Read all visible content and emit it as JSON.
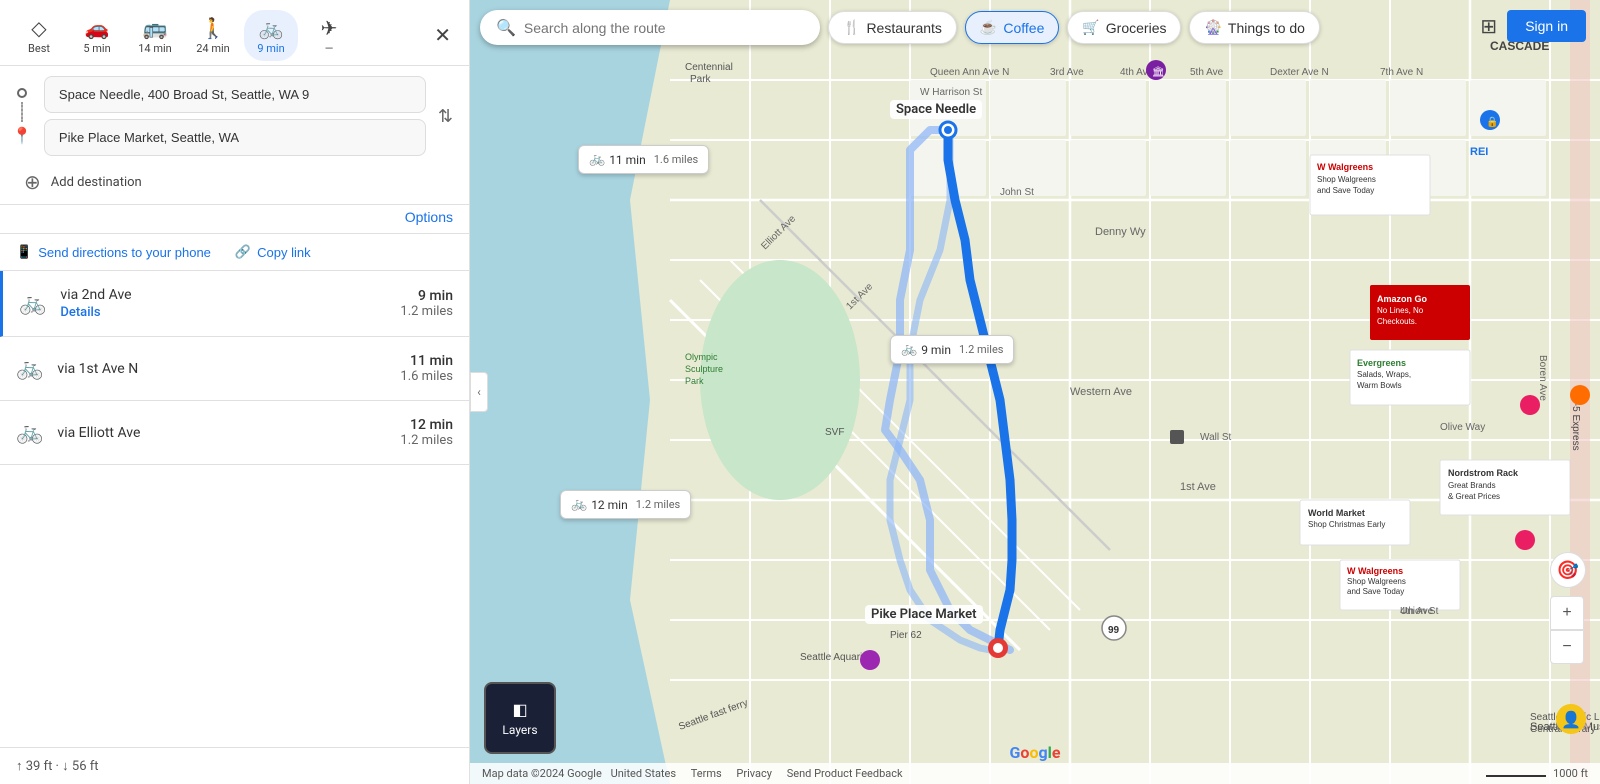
{
  "transport_options": [
    {
      "id": "best",
      "icon": "◇",
      "label": "Best",
      "active": false
    },
    {
      "id": "car",
      "icon": "🚗",
      "label": "5 min",
      "active": false
    },
    {
      "id": "transit",
      "icon": "🚌",
      "label": "14 min",
      "active": false
    },
    {
      "id": "walk",
      "icon": "🚶",
      "label": "24 min",
      "active": false
    },
    {
      "id": "bike",
      "icon": "🚲",
      "label": "9 min",
      "active": true
    },
    {
      "id": "flight",
      "icon": "✈",
      "label": "—",
      "active": false
    }
  ],
  "origin": "Space Needle, 400 Broad St, Seattle, WA 9",
  "destination": "Pike Place Market, Seattle, WA",
  "add_destination": "Add destination",
  "options_label": "Options",
  "send_directions_label": "Send directions to your phone",
  "copy_link_label": "Copy link",
  "routes": [
    {
      "id": "route1",
      "via": "via 2nd Ave",
      "time": "9 min",
      "distance": "1.2 miles",
      "show_details": true,
      "selected": true
    },
    {
      "id": "route2",
      "via": "via 1st Ave N",
      "time": "11 min",
      "distance": "1.6 miles",
      "show_details": false,
      "selected": false
    },
    {
      "id": "route3",
      "via": "via Elliott Ave",
      "time": "12 min",
      "distance": "1.2 miles",
      "show_details": false,
      "selected": false
    }
  ],
  "details_label": "Details",
  "elevation": "↑ 39 ft · ↓ 56 ft",
  "search_placeholder": "Search along the route",
  "filter_buttons": [
    {
      "id": "restaurants",
      "icon": "🍴",
      "label": "Restaurants",
      "active": false
    },
    {
      "id": "coffee",
      "icon": "☕",
      "label": "Coffee",
      "active": true
    },
    {
      "id": "groceries",
      "icon": "🛒",
      "label": "Groceries",
      "active": false
    },
    {
      "id": "things_to_do",
      "icon": "🎡",
      "label": "Things to do",
      "active": false
    }
  ],
  "sign_in_label": "Sign in",
  "layers_label": "Layers",
  "route_map_labels": [
    {
      "id": "r1",
      "time": "9 min",
      "dist": "1.2 miles"
    },
    {
      "id": "r2",
      "time": "11 min",
      "dist": "1.6 miles"
    },
    {
      "id": "r3",
      "time": "12 min",
      "dist": "1.2 miles"
    }
  ],
  "space_needle_label": "Space Needle",
  "pike_place_label": "Pike Place Market",
  "bottom_bar": {
    "data": "Map data ©2024 Google",
    "terms": "Terms",
    "privacy": "Privacy",
    "feedback": "Send Product Feedback",
    "scale": "1000 ft"
  }
}
